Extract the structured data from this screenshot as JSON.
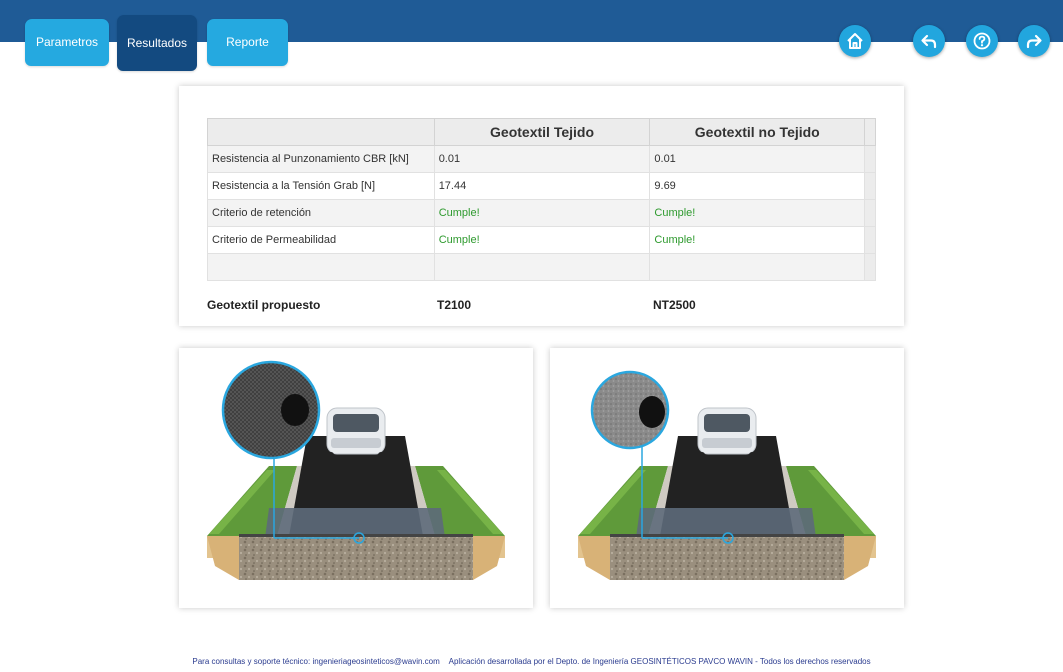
{
  "tabs": [
    {
      "label": "Parametros",
      "active": false
    },
    {
      "label": "Resultados",
      "active": true
    },
    {
      "label": "Reporte",
      "active": false
    }
  ],
  "nav_buttons": [
    "home-icon",
    "back-icon",
    "help-icon",
    "forward-icon"
  ],
  "colors": {
    "topbar": "#1f5b96",
    "tab_light": "#25a9e0",
    "tab_active": "#134a80",
    "ok_text": "#2e9a2e"
  },
  "table": {
    "headers": [
      "",
      "Geotextil Tejido",
      "Geotextil no Tejido"
    ],
    "rows": [
      [
        "Resistencia al Punzonamiento CBR [kN]",
        "0.01",
        "0.01"
      ],
      [
        "Resistencia a la Tensión Grab [N]",
        "17.44",
        "9.69"
      ],
      [
        "Criterio de retención",
        "Cumple!",
        "Cumple!"
      ],
      [
        "Criterio de Permeabilidad",
        "Cumple!",
        "Cumple!"
      ],
      [
        "",
        "",
        ""
      ]
    ],
    "proposed": {
      "label": "Geotextil propuesto",
      "tejido": "T2100",
      "no_tejido": "NT2500"
    }
  },
  "footer": {
    "support": "Para consultas y soporte técnico: ingenieriageosinteticos@wavin.com",
    "credits": "Aplicación desarrollada por el Depto. de Ingeniería GEOSINTÉTICOS PAVCO WAVIN - Todos los derechos reservados"
  }
}
